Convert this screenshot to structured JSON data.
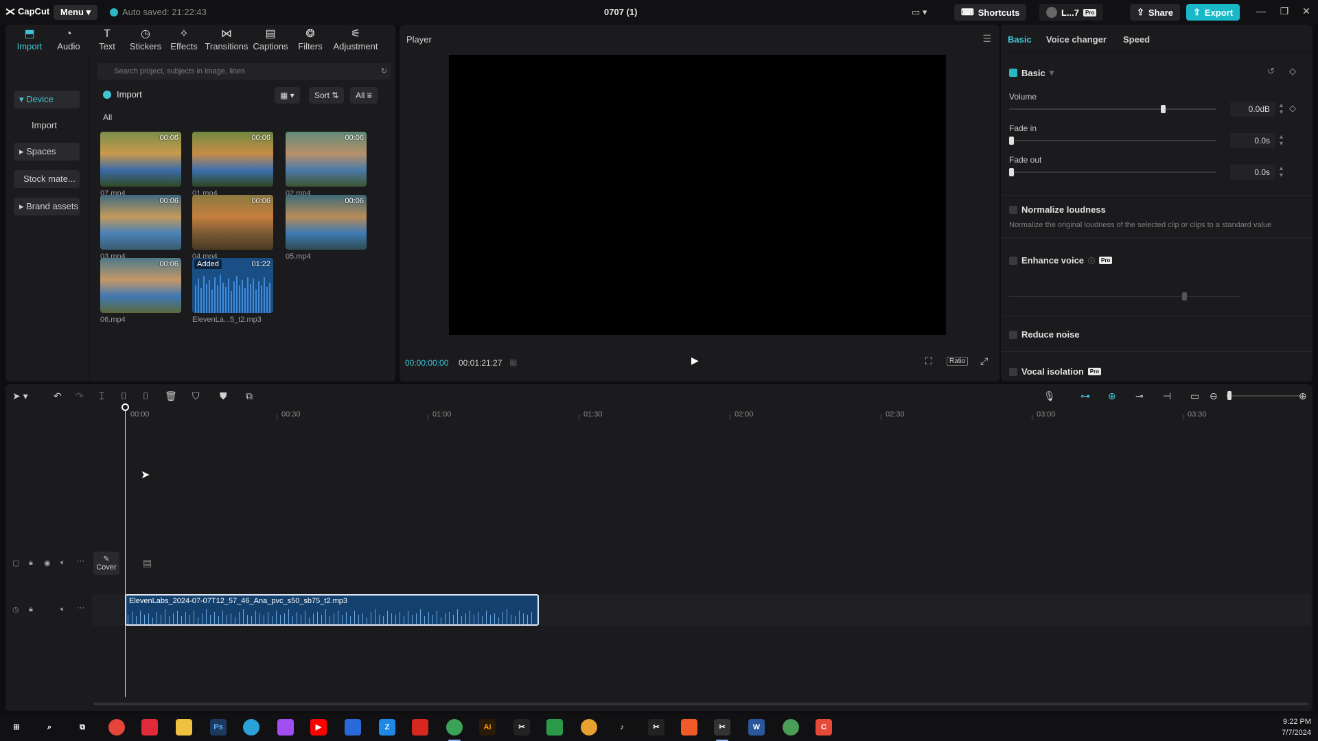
{
  "app": {
    "logo": "CapCut",
    "menu_label": "Menu",
    "autosave": "Auto saved: 21:22:43",
    "project_title": "0707 (1)",
    "shortcuts_label": "Shortcuts",
    "account_label": "L...7",
    "pro_badge": "Pro",
    "share_label": "Share",
    "export_label": "Export"
  },
  "media_tabs": [
    {
      "label": "Import",
      "icon": "import-icon"
    },
    {
      "label": "Audio",
      "icon": "audio-icon"
    },
    {
      "label": "Text",
      "icon": "text-icon"
    },
    {
      "label": "Stickers",
      "icon": "sticker-icon"
    },
    {
      "label": "Effects",
      "icon": "effects-icon"
    },
    {
      "label": "Transitions",
      "icon": "transitions-icon"
    },
    {
      "label": "Captions",
      "icon": "captions-icon"
    },
    {
      "label": "Filters",
      "icon": "filters-icon"
    },
    {
      "label": "Adjustment",
      "icon": "adjustment-icon"
    }
  ],
  "subnav": {
    "device": "Device",
    "import": "Import",
    "spaces": "Spaces",
    "stock": "Stock mate...",
    "brand": "Brand assets"
  },
  "media": {
    "search_placeholder": "Search project, subjects in image, lines",
    "import_label": "Import",
    "sort_label": "Sort",
    "filter_label": "All",
    "all_label": "All",
    "items": [
      {
        "name": "07.mp4",
        "duration": "00:06",
        "added": ""
      },
      {
        "name": "01.mp4",
        "duration": "00:06",
        "added": ""
      },
      {
        "name": "02.mp4",
        "duration": "00:06",
        "added": ""
      },
      {
        "name": "03.mp4",
        "duration": "00:06",
        "added": ""
      },
      {
        "name": "04.mp4",
        "duration": "00:06",
        "added": ""
      },
      {
        "name": "05.mp4",
        "duration": "00:06",
        "added": ""
      },
      {
        "name": "06.mp4",
        "duration": "00:06",
        "added": ""
      },
      {
        "name": "ElevenLa...5_t2.mp3",
        "duration": "01:22",
        "added": "Added"
      }
    ]
  },
  "player": {
    "title": "Player",
    "current_time": "00:00:00:00",
    "total_time": "00:01:21:27",
    "ratio_label": "Ratio"
  },
  "props": {
    "tabs": [
      "Basic",
      "Voice changer",
      "Speed"
    ],
    "basic_section": "Basic",
    "volume_label": "Volume",
    "volume_value": "0.0dB",
    "volume_level": 0.75,
    "fadein_label": "Fade in",
    "fadein_value": "0.0s",
    "fadeout_label": "Fade out",
    "fadeout_value": "0.0s",
    "normalize_label": "Normalize loudness",
    "normalize_desc": "Normalize the original loudness of the selected clip or clips to a standard value",
    "enhance_label": "Enhance voice",
    "reduce_label": "Reduce noise",
    "vocal_label": "Vocal isolation"
  },
  "timeline": {
    "ruler": [
      "00:00",
      "00:30",
      "01:00",
      "01:30",
      "02:00",
      "02:30",
      "03:00",
      "03:30"
    ],
    "cover_label": "Cover",
    "audio_clip_name": "ElevenLabs_2024-07-07T12_57_46_Ana_pvc_s50_sb75_t2.mp3"
  },
  "taskbar": {
    "time": "9:22 PM",
    "date": "7/7/2024"
  },
  "colors": {
    "accent": "#3fc6d4",
    "export": "#18b8c8",
    "clip": "#14406e"
  }
}
